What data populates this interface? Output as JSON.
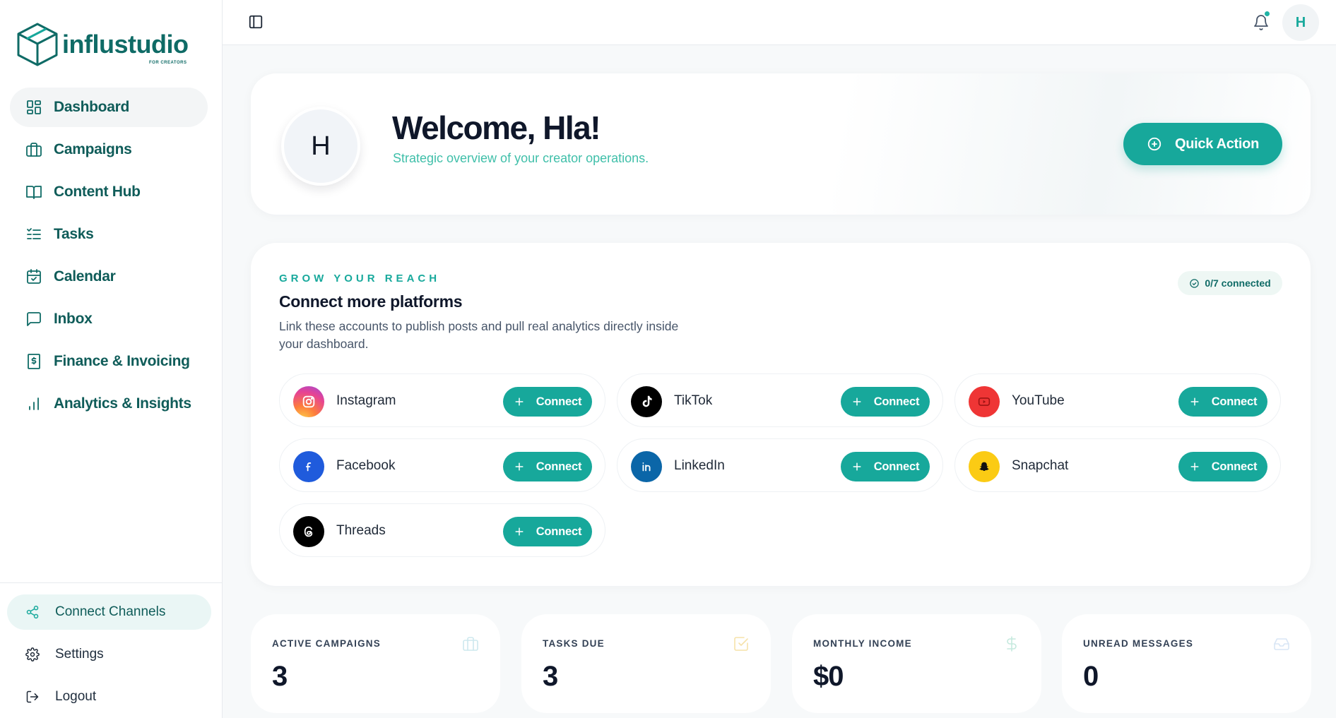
{
  "brand": {
    "name": "influstudio",
    "tagline": "FOR CREATORS",
    "color": "#0f6b66",
    "accent": "#17a89b"
  },
  "sidebar": {
    "items": [
      {
        "label": "Dashboard",
        "icon": "dashboard-icon",
        "active": true
      },
      {
        "label": "Campaigns",
        "icon": "briefcase-icon"
      },
      {
        "label": "Content Hub",
        "icon": "book-icon"
      },
      {
        "label": "Tasks",
        "icon": "list-check-icon"
      },
      {
        "label": "Calendar",
        "icon": "calendar-check-icon"
      },
      {
        "label": "Inbox",
        "icon": "message-icon"
      },
      {
        "label": "Finance & Invoicing",
        "icon": "receipt-dollar-icon"
      },
      {
        "label": "Analytics & Insights",
        "icon": "bar-chart-icon"
      }
    ],
    "bottom": [
      {
        "label": "Connect Channels",
        "icon": "share-icon"
      },
      {
        "label": "Settings",
        "icon": "gear-icon"
      },
      {
        "label": "Logout",
        "icon": "logout-icon"
      }
    ]
  },
  "topbar": {
    "avatar_initial": "H"
  },
  "welcome": {
    "avatar_initial": "H",
    "title": "Welcome, Hla!",
    "subtitle": "Strategic overview of your creator operations.",
    "quick_action_label": "Quick Action"
  },
  "grow": {
    "eyebrow": "GROW YOUR REACH",
    "title": "Connect more platforms",
    "description": "Link these accounts to publish posts and pull real analytics directly inside your dashboard.",
    "connected_badge": "0/7 connected",
    "connect_label": "Connect",
    "platforms": [
      {
        "name": "Instagram",
        "icon": "instagram-icon"
      },
      {
        "name": "TikTok",
        "icon": "tiktok-icon"
      },
      {
        "name": "YouTube",
        "icon": "youtube-icon"
      },
      {
        "name": "Facebook",
        "icon": "facebook-icon"
      },
      {
        "name": "LinkedIn",
        "icon": "linkedin-icon"
      },
      {
        "name": "Snapchat",
        "icon": "snapchat-icon"
      },
      {
        "name": "Threads",
        "icon": "threads-icon"
      }
    ]
  },
  "stats": [
    {
      "label": "ACTIVE CAMPAIGNS",
      "value": "3",
      "icon": "briefcase-icon",
      "icon_color": "#cde8ee"
    },
    {
      "label": "TASKS DUE",
      "value": "3",
      "icon": "checkbox-icon",
      "icon_color": "#f6e2a9"
    },
    {
      "label": "MONTHLY INCOME",
      "value": "$0",
      "icon": "dollar-icon",
      "icon_color": "#c5e9de"
    },
    {
      "label": "UNREAD MESSAGES",
      "value": "0",
      "icon": "inbox-icon",
      "icon_color": "#d8e6f5"
    }
  ]
}
